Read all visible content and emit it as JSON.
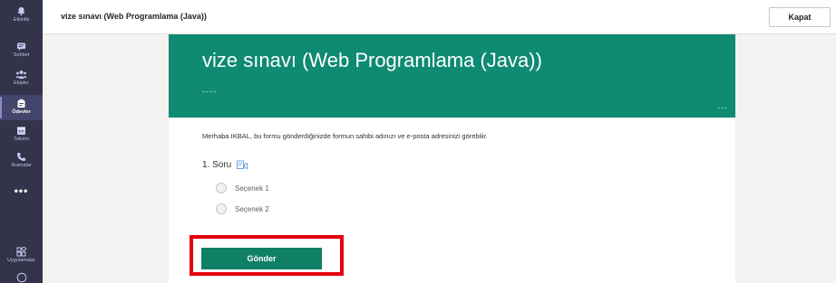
{
  "rail": {
    "items": [
      {
        "label": "Etkinlik",
        "icon": "bell-icon"
      },
      {
        "label": "Sohbet",
        "icon": "chat-icon"
      },
      {
        "label": "Ekipler",
        "icon": "teams-icon"
      },
      {
        "label": "Ödevler",
        "icon": "assignments-icon"
      },
      {
        "label": "Takvim",
        "icon": "calendar-icon"
      },
      {
        "label": "Aramalar",
        "icon": "phone-icon"
      }
    ],
    "more": "•••",
    "apps_label": "Uygulamalar"
  },
  "header": {
    "title": "vize sınavı (Web Programlama (Java))",
    "close_label": "Kapat"
  },
  "form": {
    "title": "vize sınavı (Web Programlama (Java))",
    "subtitle": "----",
    "banner_more": "...",
    "notice": "Merhaba IKBAL, bu formu gönderdiğinizde formun sahibi adınızı ve e-posta adresinizi görebilir.",
    "question": {
      "label": "1. Soru",
      "options": [
        "Seçenek 1",
        "Seçenek 2"
      ]
    },
    "submit_label": "Gönder"
  },
  "colors": {
    "rail": "#33344a",
    "banner": "#0f8a73",
    "submit": "#0f7f66",
    "highlight": "#e3000f"
  }
}
